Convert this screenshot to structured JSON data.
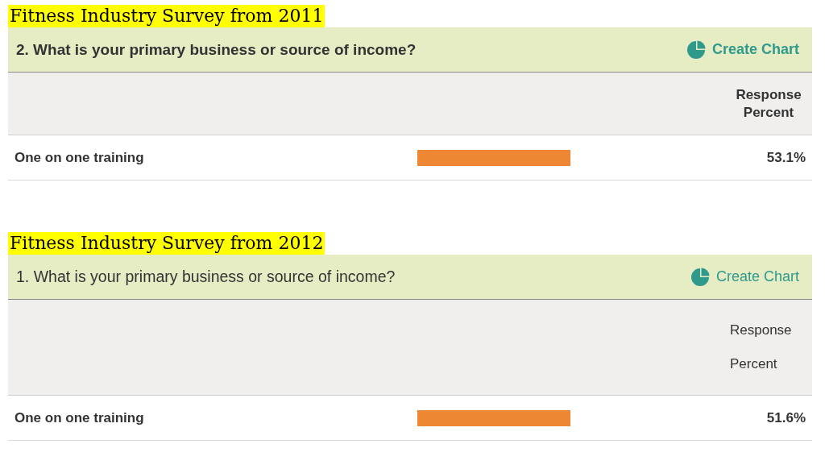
{
  "sections": [
    {
      "heading": "Fitness Industry Survey from 2011",
      "kind": "bold",
      "question": "2. What is your primary business or source of income?",
      "action": "Create Chart",
      "column_header": [
        "Response",
        "Percent"
      ],
      "rows": [
        {
          "label": "One on one training",
          "percent": "53.1%"
        }
      ]
    },
    {
      "heading": "Fitness Industry Survey from 2012",
      "kind": "plain",
      "question": "1. What is your primary business or source of income?",
      "action": "Create Chart",
      "column_header": [
        "Response",
        "Percent"
      ],
      "rows": [
        {
          "label": "One on one training",
          "percent": "51.6%"
        }
      ]
    }
  ]
}
